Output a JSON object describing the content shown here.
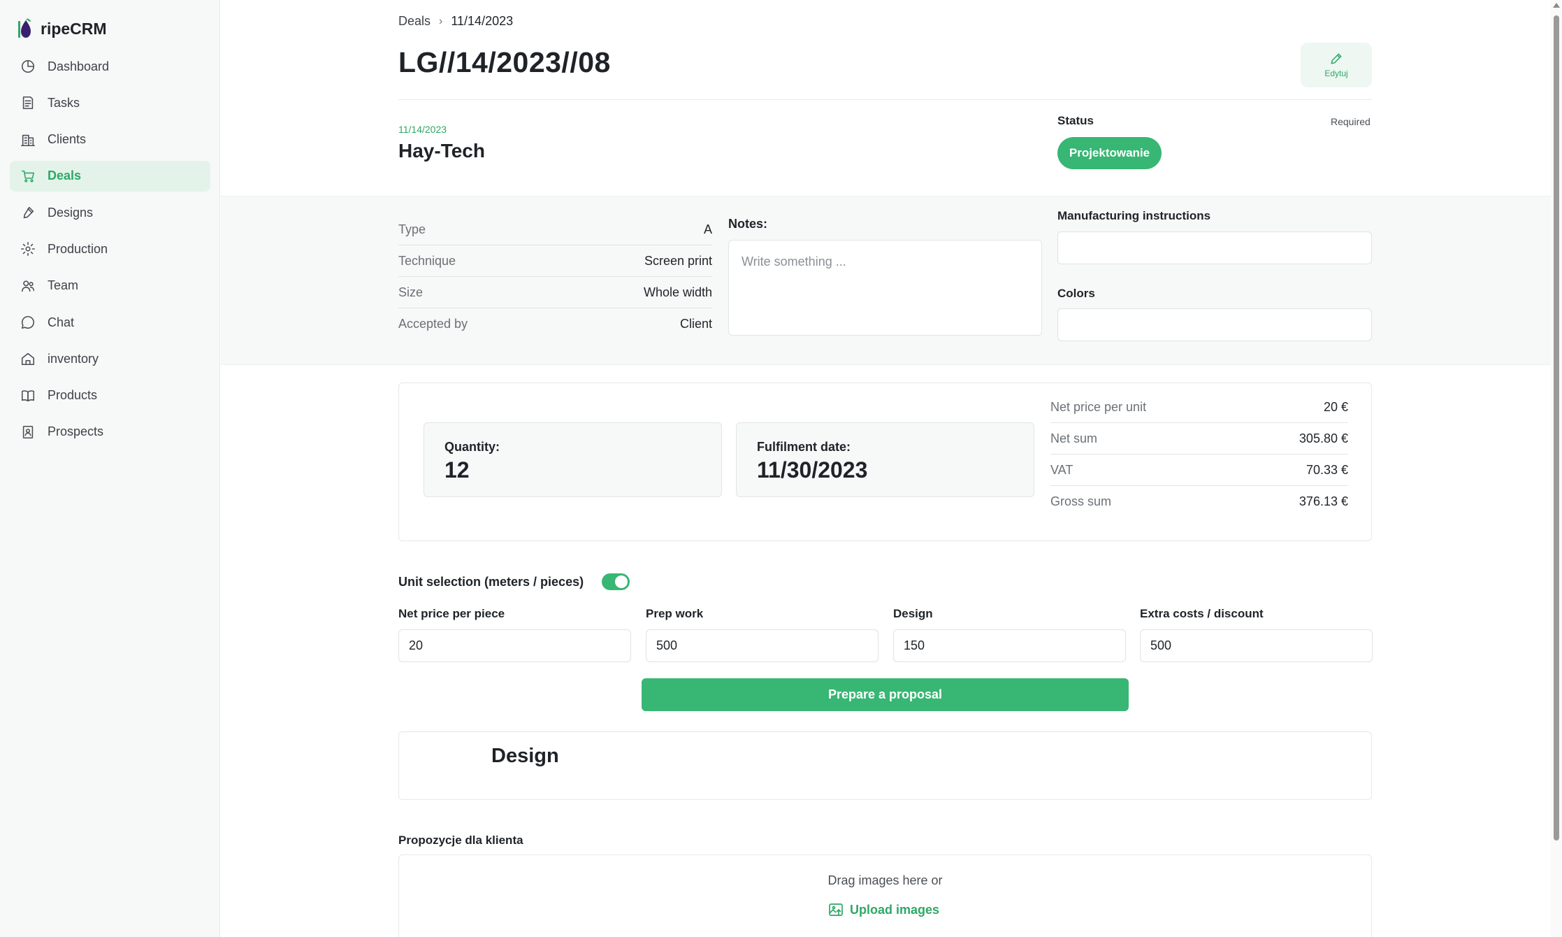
{
  "app": {
    "name": "ripeCRM"
  },
  "sidebar": {
    "items": [
      {
        "label": "Dashboard",
        "icon": "dashboard-icon",
        "active": false
      },
      {
        "label": "Tasks",
        "icon": "tasks-icon",
        "active": false
      },
      {
        "label": "Clients",
        "icon": "clients-icon",
        "active": false
      },
      {
        "label": "Deals",
        "icon": "cart-icon",
        "active": true
      },
      {
        "label": "Designs",
        "icon": "brush-icon",
        "active": false
      },
      {
        "label": "Production",
        "icon": "gear-icon",
        "active": false
      },
      {
        "label": "Team",
        "icon": "team-icon",
        "active": false
      },
      {
        "label": "Chat",
        "icon": "chat-icon",
        "active": false
      },
      {
        "label": "inventory",
        "icon": "home-icon",
        "active": false
      },
      {
        "label": "Products",
        "icon": "book-icon",
        "active": false
      },
      {
        "label": "Prospects",
        "icon": "contact-icon",
        "active": false
      }
    ]
  },
  "breadcrumb": {
    "parent": "Deals",
    "separator": "›",
    "current": "11/14/2023"
  },
  "header": {
    "title": "LG//14/2023//08",
    "edit_label": "Edytuj"
  },
  "deal": {
    "date": "11/14/2023",
    "client": "Hay-Tech"
  },
  "status": {
    "label": "Status",
    "required": "Required",
    "value": "Projektowanie",
    "color": "#38b673"
  },
  "specs": [
    {
      "key": "Type",
      "value": "A"
    },
    {
      "key": "Technique",
      "value": "Screen print"
    },
    {
      "key": "Size",
      "value": "Whole width"
    },
    {
      "key": "Accepted by",
      "value": "Client"
    }
  ],
  "notes": {
    "label": "Notes:",
    "placeholder": "Write something ..."
  },
  "manufacturing": {
    "label": "Manufacturing instructions",
    "value": ""
  },
  "colors": {
    "label": "Colors",
    "value": ""
  },
  "summary": {
    "quantity_label": "Quantity:",
    "quantity_value": "12",
    "fulfilment_label": "Fulfilment date:",
    "fulfilment_value": "11/30/2023",
    "prices": [
      {
        "key": "Net price per unit",
        "value": "20 €"
      },
      {
        "key": "Net sum",
        "value": "305.80 €"
      },
      {
        "key": "VAT",
        "value": "70.33 €"
      },
      {
        "key": "Gross sum",
        "value": "376.13 €"
      }
    ]
  },
  "unit_selection": {
    "label": "Unit selection (meters / pieces)",
    "enabled": true
  },
  "pricing_fields": [
    {
      "label": "Net price per piece",
      "value": "20"
    },
    {
      "label": "Prep work",
      "value": "500"
    },
    {
      "label": "Design",
      "value": "150"
    },
    {
      "label": "Extra costs / discount",
      "value": "500"
    }
  ],
  "proposal_button": "Prepare a proposal",
  "design_section": {
    "title": "Design"
  },
  "client_proposals": {
    "label": "Propozycje dla klienta",
    "drag_text": "Drag images here or",
    "upload_label": "Upload images"
  },
  "theme": {
    "accent": "#38b673",
    "accent_text": "#2fa866",
    "active_bg": "#e3f3ea"
  }
}
